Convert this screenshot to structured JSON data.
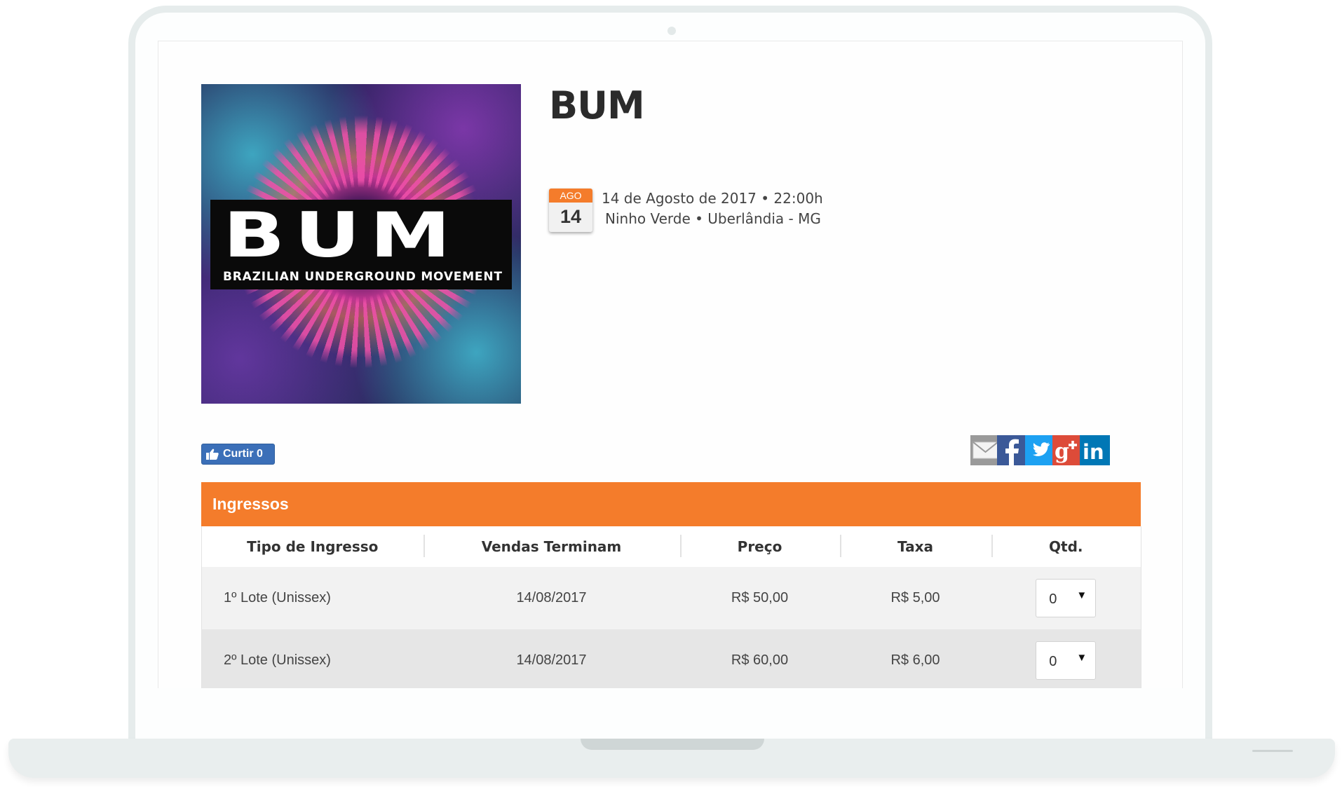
{
  "event": {
    "title": "BUM",
    "poster": {
      "logo_text": "BUM",
      "subtitle": "BRAZILIAN UNDERGROUND MOVEMENT"
    },
    "date_badge": {
      "month": "AGO",
      "day": "14"
    },
    "datetime": "14 de Agosto de 2017 • 22:00h",
    "venue": "Ninho Verde • Uberlândia - MG"
  },
  "social": {
    "like_label": "Curtir 0",
    "share_icons": [
      "email-icon",
      "facebook-icon",
      "twitter-icon",
      "google-plus-icon",
      "linkedin-icon"
    ]
  },
  "tickets": {
    "header": "Ingressos",
    "columns": [
      "Tipo de Ingresso",
      "Vendas Terminam",
      "Preço",
      "Taxa",
      "Qtd."
    ],
    "rows": [
      {
        "type": "1º Lote (Unissex)",
        "ends": "14/08/2017",
        "price": "R$ 50,00",
        "fee": "R$ 5,00",
        "qty": "0"
      },
      {
        "type": "2º Lote (Unissex)",
        "ends": "14/08/2017",
        "price": "R$ 60,00",
        "fee": "R$ 6,00",
        "qty": "0"
      }
    ]
  },
  "colors": {
    "accent": "#f47c2b",
    "facebook": "#3b5998",
    "twitter": "#1da1f2",
    "google_plus": "#dd4b39",
    "linkedin": "#0077b5"
  }
}
